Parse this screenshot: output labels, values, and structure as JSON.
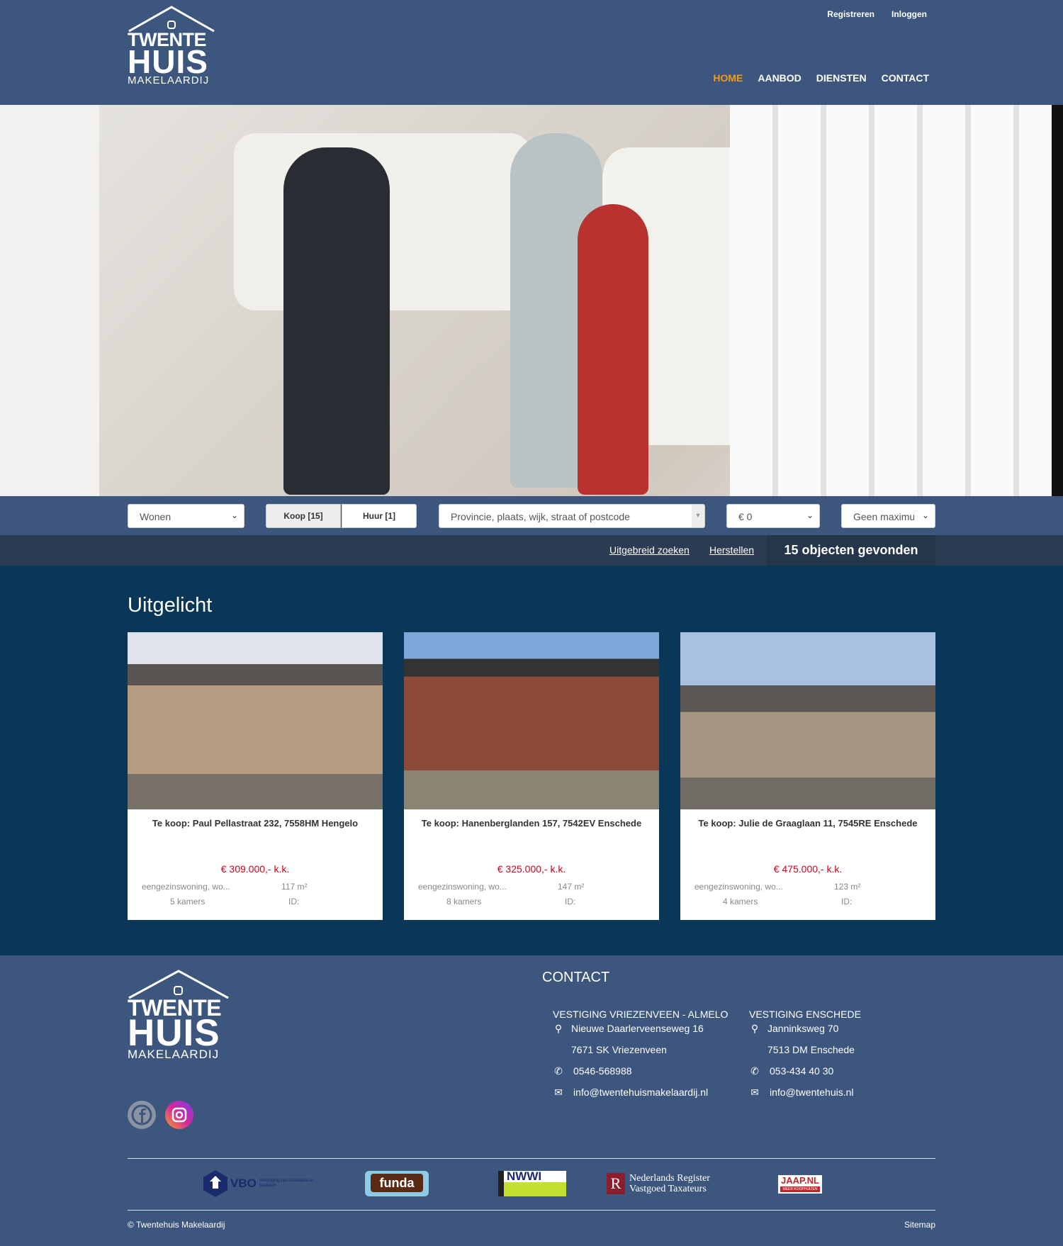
{
  "header": {
    "logo": {
      "line1": "TWENTE",
      "line2": "HUIS",
      "line3": "MAKELAARDIJ"
    },
    "top_links": [
      "Registreren",
      "Inloggen"
    ],
    "nav": [
      {
        "label": "HOME",
        "active": true
      },
      {
        "label": "AANBOD"
      },
      {
        "label": "DIENSTEN"
      },
      {
        "label": "CONTACT"
      }
    ],
    "accent": "#f39c12"
  },
  "search": {
    "type_select": "Wonen",
    "toggles": [
      "Koop [15]",
      "Huur [1]"
    ],
    "location_placeholder": "Provincie, plaats, wijk, straat of postcode",
    "min_price": "€ 0",
    "max_price": "Geen maximum"
  },
  "results": {
    "advanced": "Uitgebreid zoeken",
    "reset": "Herstellen",
    "count": "15 objecten gevonden"
  },
  "featured": {
    "title": "Uitgelicht",
    "cards": [
      {
        "title": "Te koop: Paul Pellastraat 232, 7558HM Hengelo",
        "price": "€ 309.000,- k.k.",
        "type": "eengezinswoning, wo...",
        "area": "117 m²",
        "rooms": "5 kamers",
        "id": "ID:"
      },
      {
        "title": "Te koop: Hanenberglanden 157, 7542EV Enschede",
        "price": "€ 325.000,- k.k.",
        "type": "eengezinswoning, wo...",
        "area": "147 m²",
        "rooms": "8 kamers",
        "id": "ID:"
      },
      {
        "title": "Te koop: Julie de Graaglaan 11, 7545RE Enschede",
        "price": "€ 475.000,- k.k.",
        "type": "eengezinswoning, wo...",
        "area": "123 m²",
        "rooms": "4 kamers",
        "id": "ID:"
      }
    ]
  },
  "footer": {
    "contact_title": "CONTACT",
    "offices": [
      {
        "name": "VESTIGING VRIEZENVEEN - ALMELO",
        "street": "Nieuwe Daarlerveenseweg 16",
        "city": "7671 SK Vriezenveen",
        "phone": "0546-568988",
        "email": "info@twentehuismakelaardij.nl"
      },
      {
        "name": "VESTIGING ENSCHEDE",
        "street": "Janninksweg 70",
        "city": "7513 DM Enschede",
        "phone": "053-434 40 30",
        "email": "info@twentehuis.nl"
      }
    ],
    "social": [
      "facebook-icon",
      "instagram-icon"
    ],
    "partners": {
      "vbo": "VBO",
      "vbo_sub": "Vereniging van makelaars en taxateurs",
      "funda": "funda",
      "nwwi": "NWWI",
      "nrvt": "Nederlands Register Vastgoed Taxateurs",
      "nrvt_l1": "Nederlands Register",
      "nrvt_l2": "Vastgoed Taxateurs",
      "jaap": "JAAP.NL",
      "jaap_sub": "MEER KOOPHUIZEN"
    },
    "copyright": "© Twentehuis Makelaardij",
    "sitemap": "Sitemap"
  }
}
